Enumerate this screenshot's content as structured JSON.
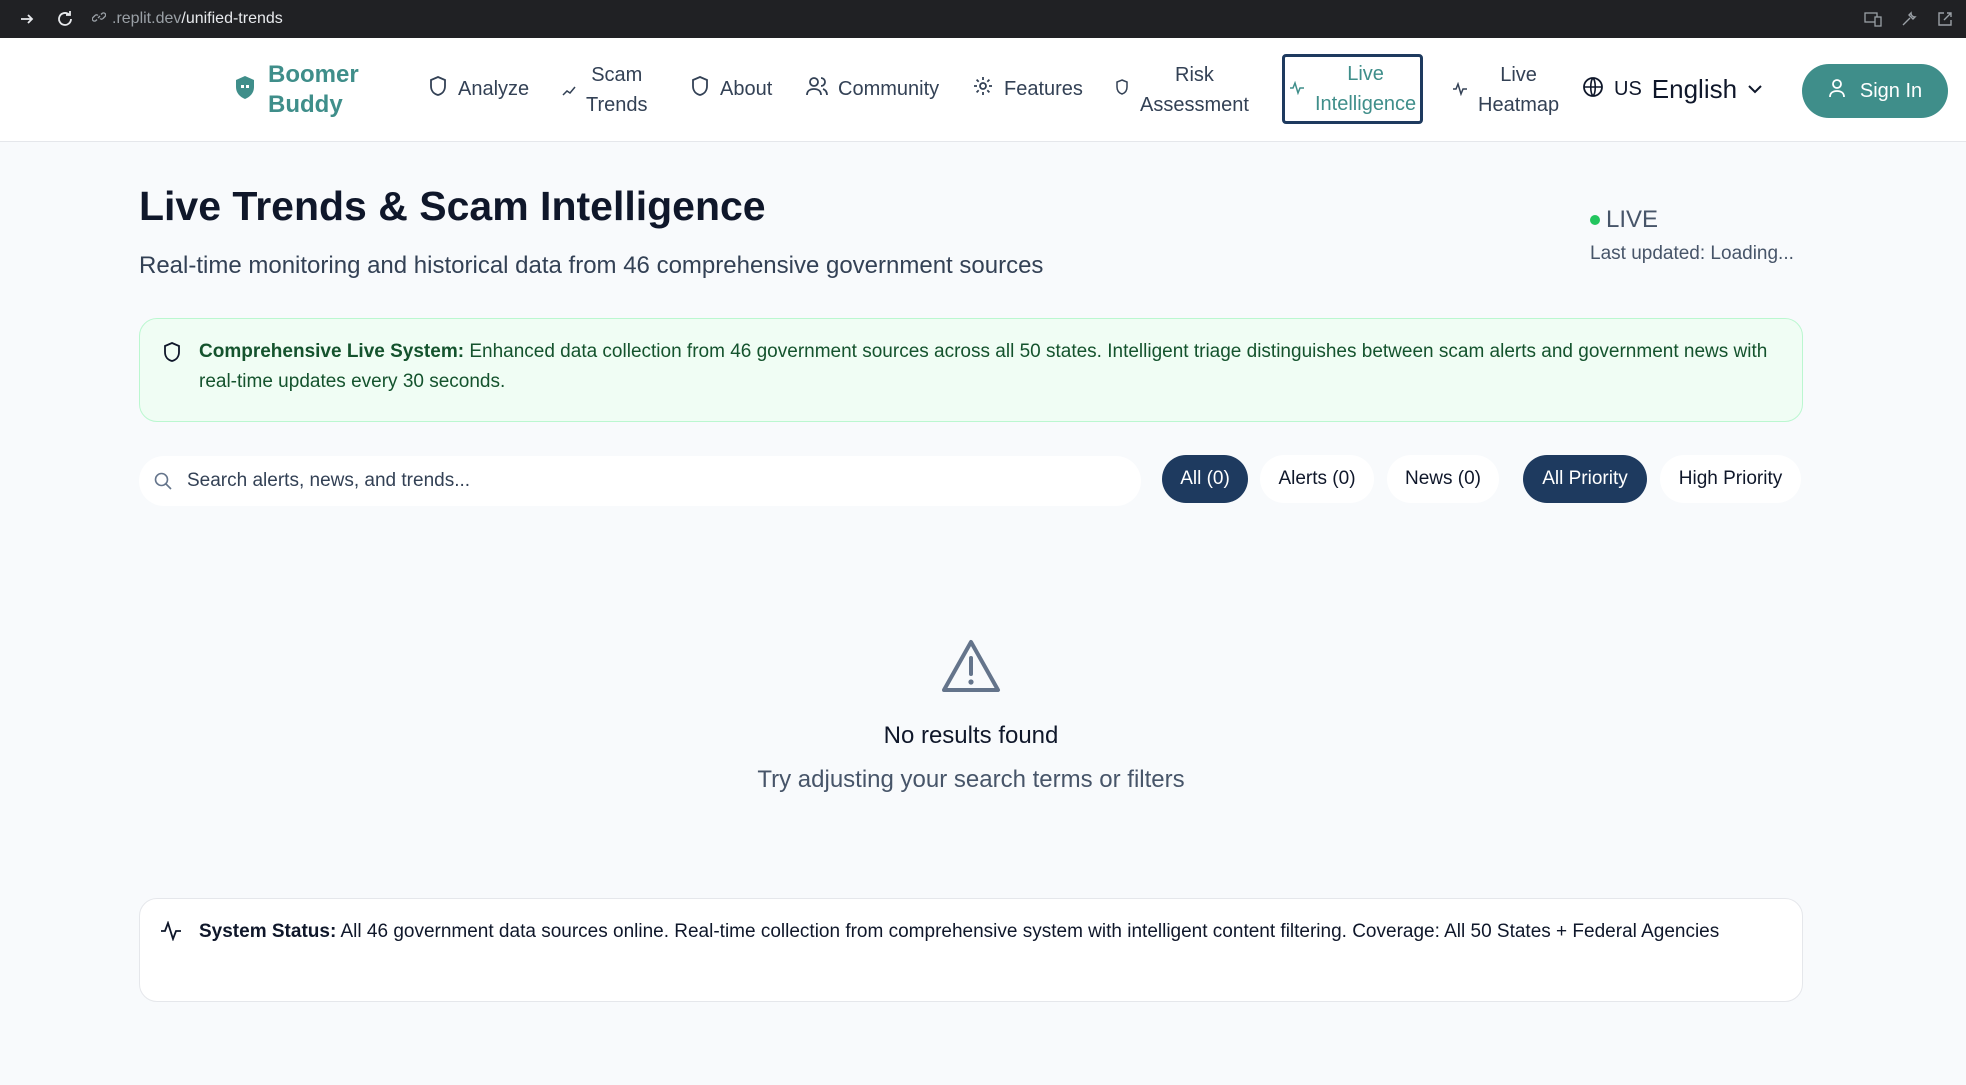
{
  "browser": {
    "url_host": ".replit.dev",
    "url_path": "/unified-trends"
  },
  "header": {
    "logo_line1": "Boomer",
    "logo_line2": "Buddy",
    "nav": [
      {
        "label": "Analyze",
        "icon": "shield-icon"
      },
      {
        "label_line1": "Scam",
        "label_line2": "Trends",
        "icon": "trending-up-icon"
      },
      {
        "label": "About",
        "icon": "shield-icon"
      },
      {
        "label": "Community",
        "icon": "users-icon"
      },
      {
        "label": "Features",
        "icon": "gear-icon"
      },
      {
        "label_line1": "Risk",
        "label_line2": "Assessment",
        "icon": "shield-icon"
      },
      {
        "label_line1": "Live",
        "label_line2": "Intelligence",
        "icon": "activity-icon",
        "active": true
      },
      {
        "label_line1": "Live",
        "label_line2": "Heatmap",
        "icon": "activity-icon"
      }
    ],
    "language_code": "US",
    "language_name": "English",
    "sign_in": "Sign In"
  },
  "main": {
    "title": "Live Trends & Scam Intelligence",
    "subtitle": "Real-time monitoring and historical data from 46 comprehensive government sources",
    "live_label": "LIVE",
    "last_updated": "Last updated: Loading...",
    "info_bold": "Comprehensive Live System:",
    "info_text": " Enhanced data collection from 46 government sources across all 50 states. Intelligent triage distinguishes between scam alerts and government news with real-time updates every 30 seconds.",
    "search_placeholder": "Search alerts, news, and trends...",
    "filters": {
      "all": "All (0)",
      "alerts": "Alerts (0)",
      "news": "News (0)",
      "all_priority": "All Priority",
      "high_priority": "High Priority"
    },
    "empty_title": "No results found",
    "empty_sub": "Try adjusting your search terms or filters",
    "status_bold": "System Status:",
    "status_text": " All 46 government data sources online. Real-time collection from comprehensive system with intelligent content filtering. Coverage: All 50 States + Federal Agencies"
  },
  "colors": {
    "brand_teal": "#3f8e8a",
    "navy": "#1e3a5f",
    "live_green": "#22c55e",
    "info_bg": "#f0fdf4"
  }
}
